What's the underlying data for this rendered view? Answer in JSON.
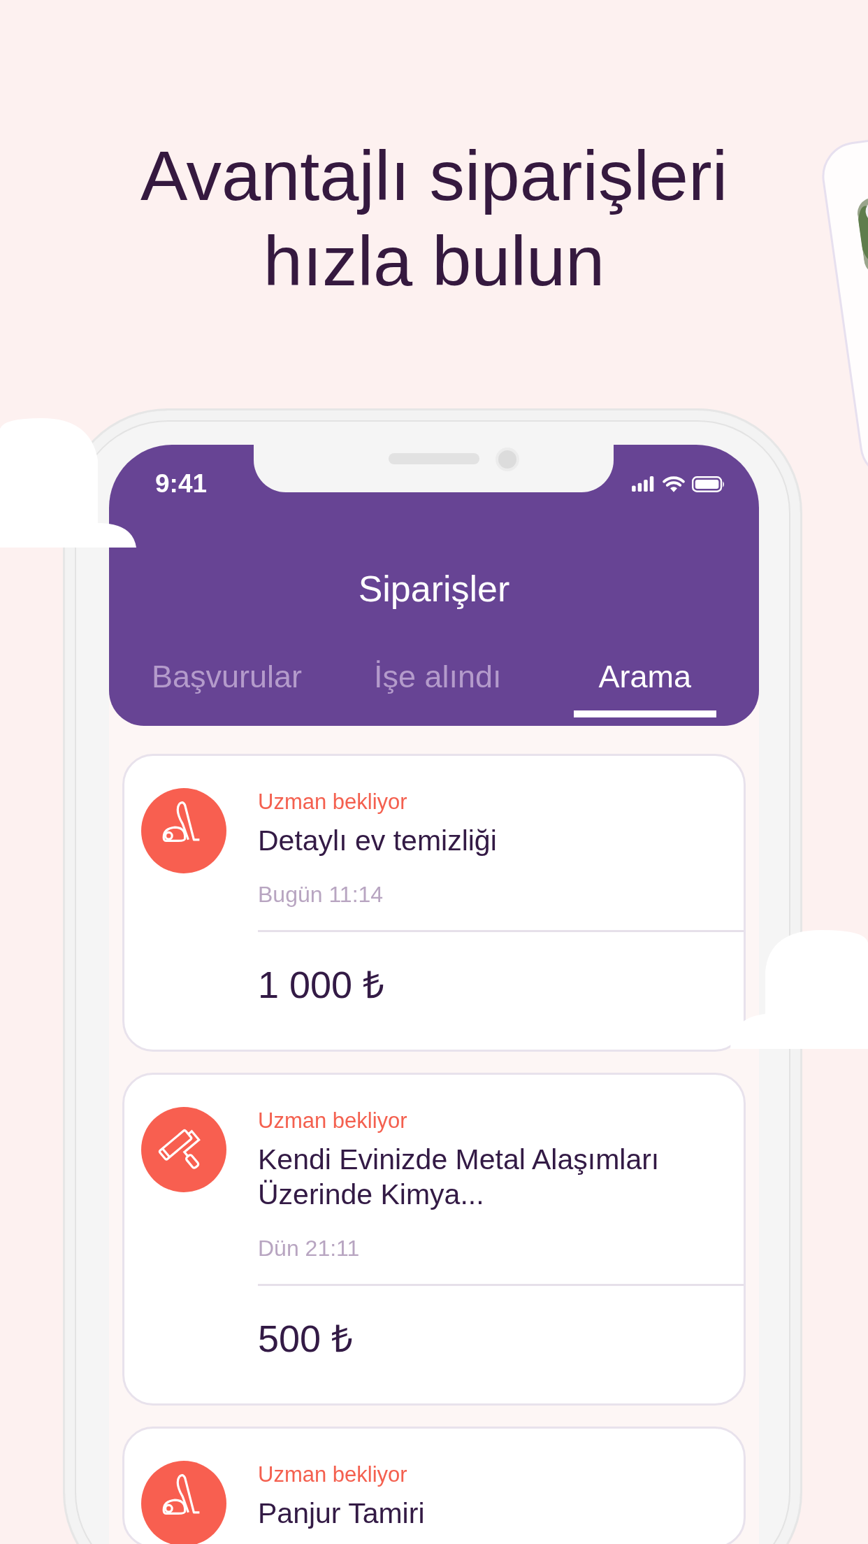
{
  "headline": "Avantajlı siparişleri\nhızla bulun",
  "status_bar": {
    "time": "9:41"
  },
  "header": {
    "title": "Siparişler"
  },
  "tabs": [
    {
      "label": "Başvurular",
      "selected": false
    },
    {
      "label": "İşe alındı",
      "selected": false
    },
    {
      "label": "Arama",
      "selected": true
    }
  ],
  "orders": [
    {
      "kind": "vacuum",
      "status": "Uzman bekliyor",
      "title": "Detaylı ev temizliği",
      "date": "Bugün 11:14",
      "price": "1 000 ₺"
    },
    {
      "kind": "roller",
      "status": "Uzman bekliyor",
      "title": "Kendi Evinizde Metal Alaşımları Üzerinde Kimya...",
      "date": "Dün 21:11",
      "price": "500 ₺"
    },
    {
      "kind": "vacuum",
      "status": "Uzman bekliyor",
      "title": "Panjur Tamiri"
    }
  ]
}
